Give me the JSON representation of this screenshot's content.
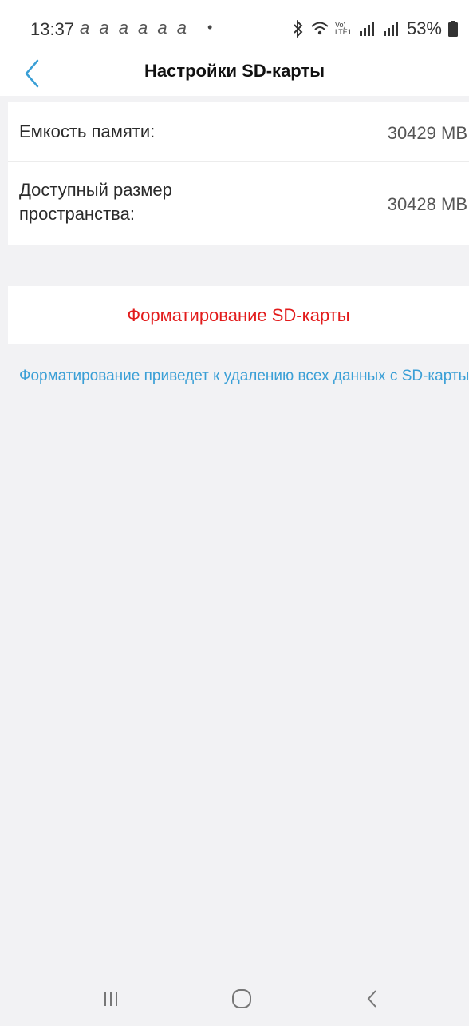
{
  "status_bar": {
    "time": "13:37",
    "notification_icons": "a a a a a a",
    "dot": "•",
    "network_label": "Vo) LTE1",
    "battery_percent": "53%"
  },
  "header": {
    "title": "Настройки SD-карты"
  },
  "storage": {
    "rows": [
      {
        "label": "Емкость памяти:",
        "value": "30429 MB"
      },
      {
        "label": "Доступный размер пространства:",
        "value": "30428 MB"
      }
    ]
  },
  "format": {
    "button_label": "Форматирование SD-карты",
    "note": "Форматирование приведет к удалению всех данных с SD-карты"
  },
  "colors": {
    "accent_blue": "#3a9fd6",
    "danger_red": "#e21b1b",
    "background": "#f2f2f4"
  }
}
